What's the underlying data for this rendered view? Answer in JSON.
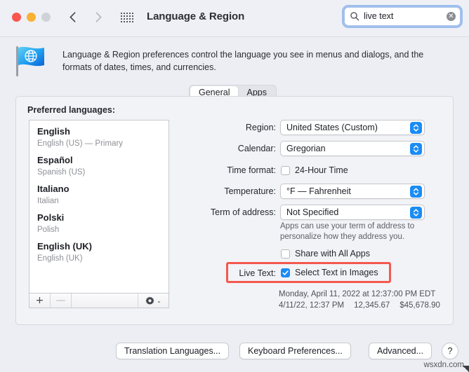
{
  "window": {
    "title": "Language & Region",
    "traffic_lights": [
      "close",
      "minimize",
      "zoom"
    ],
    "colors": {
      "close": "#f9564f",
      "minimize": "#f8b133",
      "zoom": "#cfd2d6",
      "accent": "#1a8cf5",
      "annotation": "#f4584e"
    }
  },
  "search": {
    "value": "live text",
    "placeholder": "Search",
    "clear_glyph": "✕"
  },
  "header": {
    "description": "Language & Region preferences control the language you see in menus and dialogs, and the formats of dates, times, and currencies."
  },
  "tabs": [
    {
      "label": "General",
      "active": true
    },
    {
      "label": "Apps",
      "active": false
    }
  ],
  "languages": {
    "label": "Preferred languages:",
    "items": [
      {
        "name": "English",
        "sub": "English (US) — Primary"
      },
      {
        "name": "Español",
        "sub": "Spanish (US)"
      },
      {
        "name": "Italiano",
        "sub": "Italian"
      },
      {
        "name": "Polski",
        "sub": "Polish"
      },
      {
        "name": "English (UK)",
        "sub": "English (UK)"
      }
    ],
    "toolbar": {
      "add": "+",
      "remove": "—",
      "gear_chevron": "⌄"
    }
  },
  "form": {
    "region": {
      "label": "Region:",
      "value": "United States (Custom)"
    },
    "calendar": {
      "label": "Calendar:",
      "value": "Gregorian"
    },
    "time_format": {
      "label": "Time format:",
      "checkbox_label": "24-Hour Time",
      "checked": false
    },
    "temperature": {
      "label": "Temperature:",
      "value": "°F — Fahrenheit"
    },
    "term_of_address": {
      "label": "Term of address:",
      "value": "Not Specified"
    },
    "helper_text": "Apps can use your term of address to personalize how they address you.",
    "share_all_apps": {
      "checkbox_label": "Share with All Apps",
      "checked": false
    },
    "live_text": {
      "label": "Live Text:",
      "checkbox_label": "Select Text in Images",
      "checked": true
    }
  },
  "preview": {
    "line1": "Monday, April 11, 2022 at 12:37:00 PM EDT",
    "line2_date": "4/11/22, 12:37 PM",
    "line2_number": "12,345.67",
    "line2_currency": "$45,678.90"
  },
  "buttons": {
    "translation": "Translation Languages...",
    "keyboard": "Keyboard Preferences...",
    "advanced": "Advanced...",
    "help": "?"
  },
  "watermark": "wsxdn.com"
}
